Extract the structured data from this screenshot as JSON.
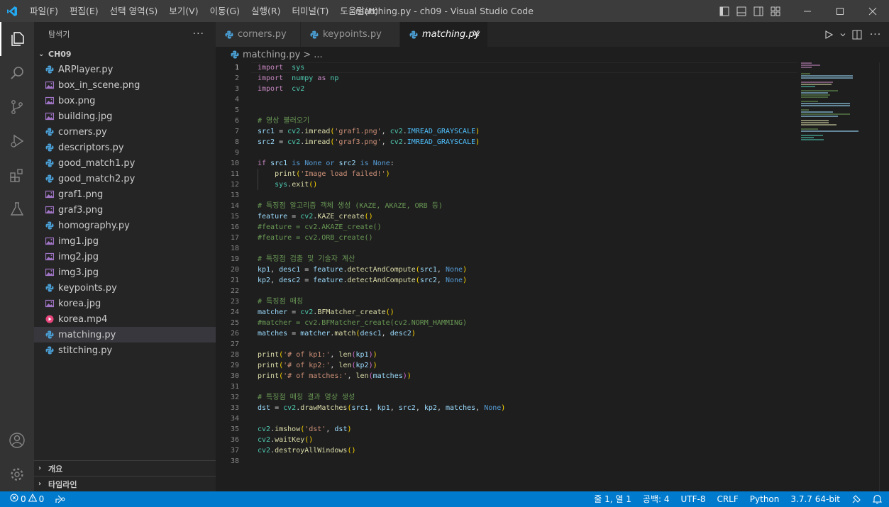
{
  "titlebar": {
    "menu": [
      "파일(F)",
      "편집(E)",
      "선택 영역(S)",
      "보기(V)",
      "이동(G)",
      "실행(R)",
      "터미널(T)",
      "도움말(H)"
    ],
    "title": "matching.py - ch09 - Visual Studio Code"
  },
  "sidebar": {
    "header": "탐색기",
    "more": "···",
    "folder": "CH09",
    "files": [
      {
        "name": "ARPlayer.py",
        "type": "py"
      },
      {
        "name": "box_in_scene.png",
        "type": "img"
      },
      {
        "name": "box.png",
        "type": "img"
      },
      {
        "name": "building.jpg",
        "type": "img"
      },
      {
        "name": "corners.py",
        "type": "py"
      },
      {
        "name": "descriptors.py",
        "type": "py"
      },
      {
        "name": "good_match1.py",
        "type": "py"
      },
      {
        "name": "good_match2.py",
        "type": "py"
      },
      {
        "name": "graf1.png",
        "type": "img"
      },
      {
        "name": "graf3.png",
        "type": "img"
      },
      {
        "name": "homography.py",
        "type": "py"
      },
      {
        "name": "img1.jpg",
        "type": "img"
      },
      {
        "name": "img2.jpg",
        "type": "img"
      },
      {
        "name": "img3.jpg",
        "type": "img"
      },
      {
        "name": "keypoints.py",
        "type": "py"
      },
      {
        "name": "korea.jpg",
        "type": "img"
      },
      {
        "name": "korea.mp4",
        "type": "video"
      },
      {
        "name": "matching.py",
        "type": "py",
        "selected": true
      },
      {
        "name": "stitching.py",
        "type": "py"
      }
    ],
    "outline": "개요",
    "timeline": "타임라인"
  },
  "tabs": [
    {
      "label": "corners.py",
      "active": false
    },
    {
      "label": "keypoints.py",
      "active": false
    },
    {
      "label": "matching.py",
      "active": true
    }
  ],
  "breadcrumb": {
    "file": "matching.py",
    "sep": ">",
    "rest": "..."
  },
  "code": {
    "current_line": 1,
    "lines": [
      [
        [
          "kw",
          "import"
        ],
        [
          "",
          "  "
        ],
        [
          "mod",
          "sys"
        ]
      ],
      [
        [
          "kw",
          "import"
        ],
        [
          "",
          "  "
        ],
        [
          "mod",
          "numpy"
        ],
        [
          "",
          " "
        ],
        [
          "kw",
          "as"
        ],
        [
          "",
          " "
        ],
        [
          "mod",
          "np"
        ]
      ],
      [
        [
          "kw",
          "import"
        ],
        [
          "",
          "  "
        ],
        [
          "mod",
          "cv2"
        ]
      ],
      [],
      [],
      [
        [
          "cmt",
          "# 영상 불러오기"
        ]
      ],
      [
        [
          "var",
          "src1"
        ],
        [
          "",
          " = "
        ],
        [
          "mod",
          "cv2"
        ],
        [
          "",
          "."
        ],
        [
          "fn",
          "imread"
        ],
        [
          "p1",
          "("
        ],
        [
          "str",
          "'graf1.png'"
        ],
        [
          "",
          ", "
        ],
        [
          "mod",
          "cv2"
        ],
        [
          "",
          "."
        ],
        [
          "cst",
          "IMREAD_GRAYSCALE"
        ],
        [
          "p1",
          ")"
        ]
      ],
      [
        [
          "var",
          "src2"
        ],
        [
          "",
          " = "
        ],
        [
          "mod",
          "cv2"
        ],
        [
          "",
          "."
        ],
        [
          "fn",
          "imread"
        ],
        [
          "p1",
          "("
        ],
        [
          "str",
          "'graf3.png'"
        ],
        [
          "",
          ", "
        ],
        [
          "mod",
          "cv2"
        ],
        [
          "",
          "."
        ],
        [
          "cst",
          "IMREAD_GRAYSCALE"
        ],
        [
          "p1",
          ")"
        ]
      ],
      [],
      [
        [
          "kw",
          "if"
        ],
        [
          "",
          " "
        ],
        [
          "var",
          "src1"
        ],
        [
          "",
          " "
        ],
        [
          "kw2",
          "is"
        ],
        [
          "",
          " "
        ],
        [
          "kw2",
          "None"
        ],
        [
          "",
          " "
        ],
        [
          "kw2",
          "or"
        ],
        [
          "",
          " "
        ],
        [
          "var",
          "src2"
        ],
        [
          "",
          " "
        ],
        [
          "kw2",
          "is"
        ],
        [
          "",
          " "
        ],
        [
          "kw2",
          "None"
        ],
        [
          "",
          ":"
        ]
      ],
      [
        [
          "",
          "    "
        ],
        [
          "fn",
          "print"
        ],
        [
          "p1",
          "("
        ],
        [
          "str",
          "'Image load failed!'"
        ],
        [
          "p1",
          ")"
        ]
      ],
      [
        [
          "",
          "    "
        ],
        [
          "mod",
          "sys"
        ],
        [
          "",
          "."
        ],
        [
          "fn",
          "exit"
        ],
        [
          "p1",
          "()"
        ]
      ],
      [],
      [
        [
          "cmt",
          "# 특징점 알고리즘 객체 생성 (KAZE, AKAZE, ORB 등)"
        ]
      ],
      [
        [
          "var",
          "feature"
        ],
        [
          "",
          " = "
        ],
        [
          "mod",
          "cv2"
        ],
        [
          "",
          "."
        ],
        [
          "fn",
          "KAZE_create"
        ],
        [
          "p1",
          "()"
        ]
      ],
      [
        [
          "cmt",
          "#feature = cv2.AKAZE_create()"
        ]
      ],
      [
        [
          "cmt",
          "#feature = cv2.ORB_create()"
        ]
      ],
      [],
      [
        [
          "cmt",
          "# 특징점 검출 및 기술자 계산"
        ]
      ],
      [
        [
          "var",
          "kp1"
        ],
        [
          "",
          ", "
        ],
        [
          "var",
          "desc1"
        ],
        [
          "",
          " = "
        ],
        [
          "var",
          "feature"
        ],
        [
          "",
          "."
        ],
        [
          "fn",
          "detectAndCompute"
        ],
        [
          "p1",
          "("
        ],
        [
          "var",
          "src1"
        ],
        [
          "",
          ", "
        ],
        [
          "kw2",
          "None"
        ],
        [
          "p1",
          ")"
        ]
      ],
      [
        [
          "var",
          "kp2"
        ],
        [
          "",
          ", "
        ],
        [
          "var",
          "desc2"
        ],
        [
          "",
          " = "
        ],
        [
          "var",
          "feature"
        ],
        [
          "",
          "."
        ],
        [
          "fn",
          "detectAndCompute"
        ],
        [
          "p1",
          "("
        ],
        [
          "var",
          "src2"
        ],
        [
          "",
          ", "
        ],
        [
          "kw2",
          "None"
        ],
        [
          "p1",
          ")"
        ]
      ],
      [],
      [
        [
          "cmt",
          "# 특징점 매칭"
        ]
      ],
      [
        [
          "var",
          "matcher"
        ],
        [
          "",
          " = "
        ],
        [
          "mod",
          "cv2"
        ],
        [
          "",
          "."
        ],
        [
          "fn",
          "BFMatcher_create"
        ],
        [
          "p1",
          "()"
        ]
      ],
      [
        [
          "cmt",
          "#matcher = cv2.BFMatcher_create(cv2.NORM_HAMMING)"
        ]
      ],
      [
        [
          "var",
          "matches"
        ],
        [
          "",
          " = "
        ],
        [
          "var",
          "matcher"
        ],
        [
          "",
          "."
        ],
        [
          "fn",
          "match"
        ],
        [
          "p1",
          "("
        ],
        [
          "var",
          "desc1"
        ],
        [
          "",
          ", "
        ],
        [
          "var",
          "desc2"
        ],
        [
          "p1",
          ")"
        ]
      ],
      [],
      [
        [
          "fn",
          "print"
        ],
        [
          "p1",
          "("
        ],
        [
          "str",
          "'# of kp1:'"
        ],
        [
          "",
          ", "
        ],
        [
          "fn",
          "len"
        ],
        [
          "p2",
          "("
        ],
        [
          "var",
          "kp1"
        ],
        [
          "p2",
          ")"
        ],
        [
          "p1",
          ")"
        ]
      ],
      [
        [
          "fn",
          "print"
        ],
        [
          "p1",
          "("
        ],
        [
          "str",
          "'# of kp2:'"
        ],
        [
          "",
          ", "
        ],
        [
          "fn",
          "len"
        ],
        [
          "p2",
          "("
        ],
        [
          "var",
          "kp2"
        ],
        [
          "p2",
          ")"
        ],
        [
          "p1",
          ")"
        ]
      ],
      [
        [
          "fn",
          "print"
        ],
        [
          "p1",
          "("
        ],
        [
          "str",
          "'# of matches:'"
        ],
        [
          "",
          ", "
        ],
        [
          "fn",
          "len"
        ],
        [
          "p2",
          "("
        ],
        [
          "var",
          "matches"
        ],
        [
          "p2",
          ")"
        ],
        [
          "p1",
          ")"
        ]
      ],
      [],
      [
        [
          "cmt",
          "# 특징점 매칭 결과 영상 생성"
        ]
      ],
      [
        [
          "var",
          "dst"
        ],
        [
          "",
          " = "
        ],
        [
          "mod",
          "cv2"
        ],
        [
          "",
          "."
        ],
        [
          "fn",
          "drawMatches"
        ],
        [
          "p1",
          "("
        ],
        [
          "var",
          "src1"
        ],
        [
          "",
          ", "
        ],
        [
          "var",
          "kp1"
        ],
        [
          "",
          ", "
        ],
        [
          "var",
          "src2"
        ],
        [
          "",
          ", "
        ],
        [
          "var",
          "kp2"
        ],
        [
          "",
          ", "
        ],
        [
          "var",
          "matches"
        ],
        [
          "",
          ", "
        ],
        [
          "kw2",
          "None"
        ],
        [
          "p1",
          ")"
        ]
      ],
      [],
      [
        [
          "mod",
          "cv2"
        ],
        [
          "",
          "."
        ],
        [
          "fn",
          "imshow"
        ],
        [
          "p1",
          "("
        ],
        [
          "str",
          "'dst'"
        ],
        [
          "",
          ", "
        ],
        [
          "var",
          "dst"
        ],
        [
          "p1",
          ")"
        ]
      ],
      [
        [
          "mod",
          "cv2"
        ],
        [
          "",
          "."
        ],
        [
          "fn",
          "waitKey"
        ],
        [
          "p1",
          "()"
        ]
      ],
      [
        [
          "mod",
          "cv2"
        ],
        [
          "",
          "."
        ],
        [
          "fn",
          "destroyAllWindows"
        ],
        [
          "p1",
          "()"
        ]
      ],
      []
    ]
  },
  "statusbar": {
    "errors": "0",
    "warnings": "0",
    "position": "줄 1, 열 1",
    "indent": "공백: 4",
    "encoding": "UTF-8",
    "eol": "CRLF",
    "language": "Python",
    "interpreter": "3.7.7 64-bit"
  },
  "colors": {
    "accent": "#007acc",
    "py_icon": "#4a9fd5",
    "img_icon": "#a074c4",
    "video_icon": "#e8467c"
  }
}
